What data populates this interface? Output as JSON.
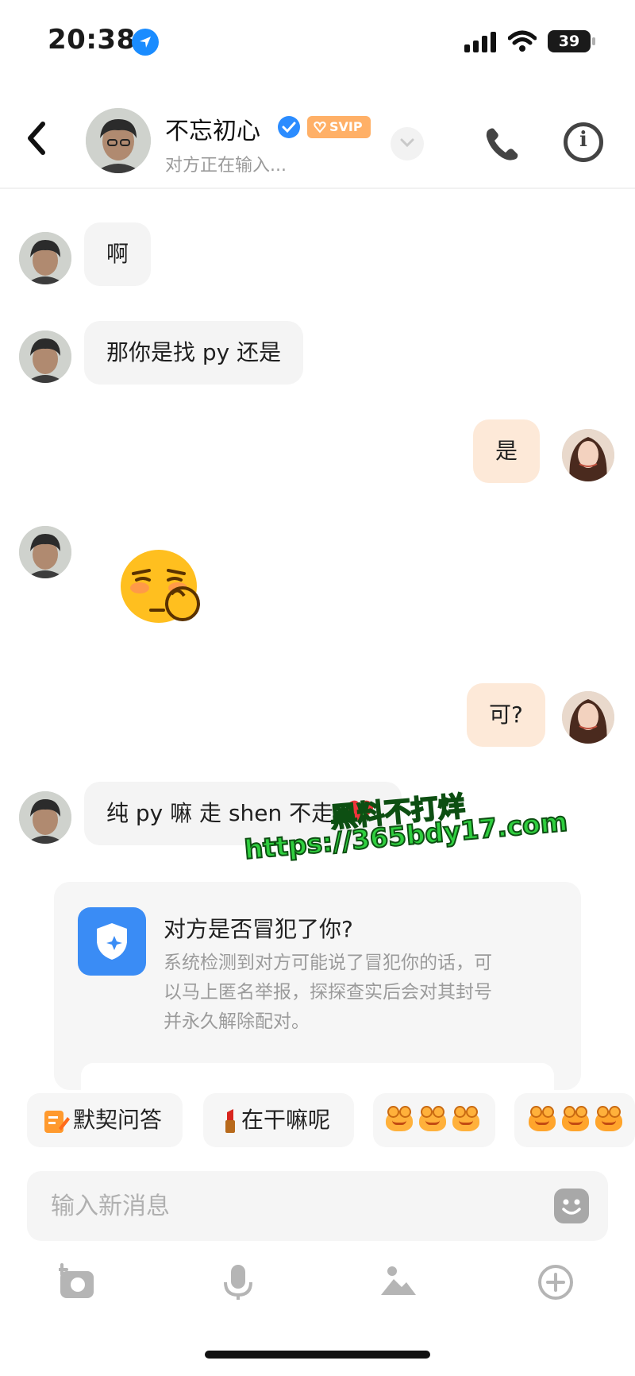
{
  "status_bar": {
    "time": "20:38",
    "battery": "39"
  },
  "header": {
    "name": "不忘初心",
    "badge": "SVIP",
    "typing_status": "对方正在输入..."
  },
  "messages": [
    {
      "side": "in",
      "text": "啊"
    },
    {
      "side": "in",
      "text": "那你是找 py 还是"
    },
    {
      "side": "out",
      "text": "是"
    },
    {
      "side": "in",
      "type": "emoji",
      "emoji": "smirking-face-sticker"
    },
    {
      "side": "out",
      "text": "可?"
    },
    {
      "side": "in",
      "text": "纯 py 嘛 走 shen 不走"
    }
  ],
  "watermark": {
    "line1": "黑料不打烊",
    "line2": "https://365bdy17.com"
  },
  "report_card": {
    "title": "对方是否冒犯了你?",
    "body": "系统检测到对方可能说了冒犯你的话，可\n以马上匿名举报，探探查实后会对其封号\n并永久解除配对。"
  },
  "quick_replies": [
    {
      "label": "默契问答",
      "icon": "pencil-note-icon"
    },
    {
      "label": "在干嘛呢",
      "icon": "lipstick-icon"
    },
    {
      "label": "",
      "icon": "three-frogs-sticker"
    },
    {
      "label": "",
      "icon": "three-puppies-sticker"
    }
  ],
  "input": {
    "placeholder": "输入新消息",
    "value": ""
  },
  "toolbar": [
    "camera-icon",
    "microphone-icon",
    "image-icon",
    "plus-circle-icon"
  ],
  "colors": {
    "outgoing_bubble": "#fde9d8",
    "incoming_bubble": "#f4f4f4",
    "accent_blue": "#3a8cf5",
    "svip_orange": "#ffb067",
    "watermark_green": "#2fcf3f"
  }
}
